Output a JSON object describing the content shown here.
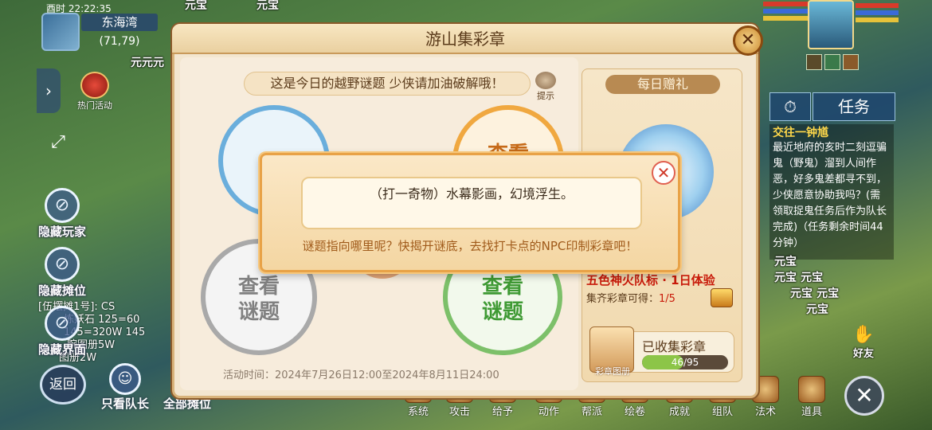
{
  "hud": {
    "time": "酉时 22:22:35",
    "map_name": "东海湾",
    "coords": "(71,79)",
    "hot_activity": "热门活动",
    "top_gold_labels": [
      "元宝",
      "元宝"
    ],
    "map_side_gold": "元元元",
    "hide_player": "隐藏玩家",
    "hide_stall": "隐藏摊位",
    "hide_ui": "隐藏界面",
    "stall_lines": [
      "[伍摆摊1号]: CS",
      "炼妖石 125=60",
      "145=320W 145",
      "腕图册5W",
      "图册2W"
    ],
    "back": "返回",
    "leader_only": "只看队长",
    "all_stalls": "全部摊位"
  },
  "task": {
    "tab_label": "任务",
    "title": "交往一钟馗",
    "description": "最近地府的亥时二刻逗骗鬼（野鬼）溜到人间作恶，好多鬼差都寻不到，少侠愿意协助我吗？(需领取捉鬼任务后作为队长完成)（任务剩余时间44分钟）",
    "gold_labels": [
      "元宝",
      "元宝",
      "元宝",
      "元宝",
      "元宝",
      "元宝"
    ],
    "friends": "好友"
  },
  "bottom_bar": [
    "系统",
    "攻击",
    "给予",
    "动作",
    "帮派",
    "绘卷",
    "成就",
    "组队",
    "法术",
    "道具"
  ],
  "panel": {
    "title": "游山集彩章",
    "banner": "这是今日的越野谜题 少侠请加油破解哦！",
    "hint": "提示",
    "stamp_labels": [
      "查看",
      "查看\n谜题",
      "查看\n谜题"
    ],
    "activity_time": "活动时间：2024年7月26日12:00至2024年8月11日24:00",
    "daily_gift": "每日赠礼",
    "reward_name": "五色神火队标 · 1日体验",
    "reward_cond_label": "集齐彩章可得：",
    "reward_cond_value": "1/5",
    "album": "彩章图册",
    "collected_label": "已收集彩章",
    "collected_value": "46/95",
    "collected_fraction": 0.484
  },
  "popup": {
    "riddle": "（打一奇物）水幕影画，幻境浮生。",
    "hint": "谜题指向哪里呢？快揭开谜底，去找打卡点的NPC印制彩章吧！"
  },
  "colors": {
    "panel_bg": "#f3e6cf",
    "stamp_gray": "#a9a9a9",
    "stamp_green": "#7cc069",
    "stamp_blue": "#6aaedc",
    "stamp_orange": "#f0a840",
    "reward_red": "#c81a0a",
    "progress_green": "#8cc548"
  }
}
